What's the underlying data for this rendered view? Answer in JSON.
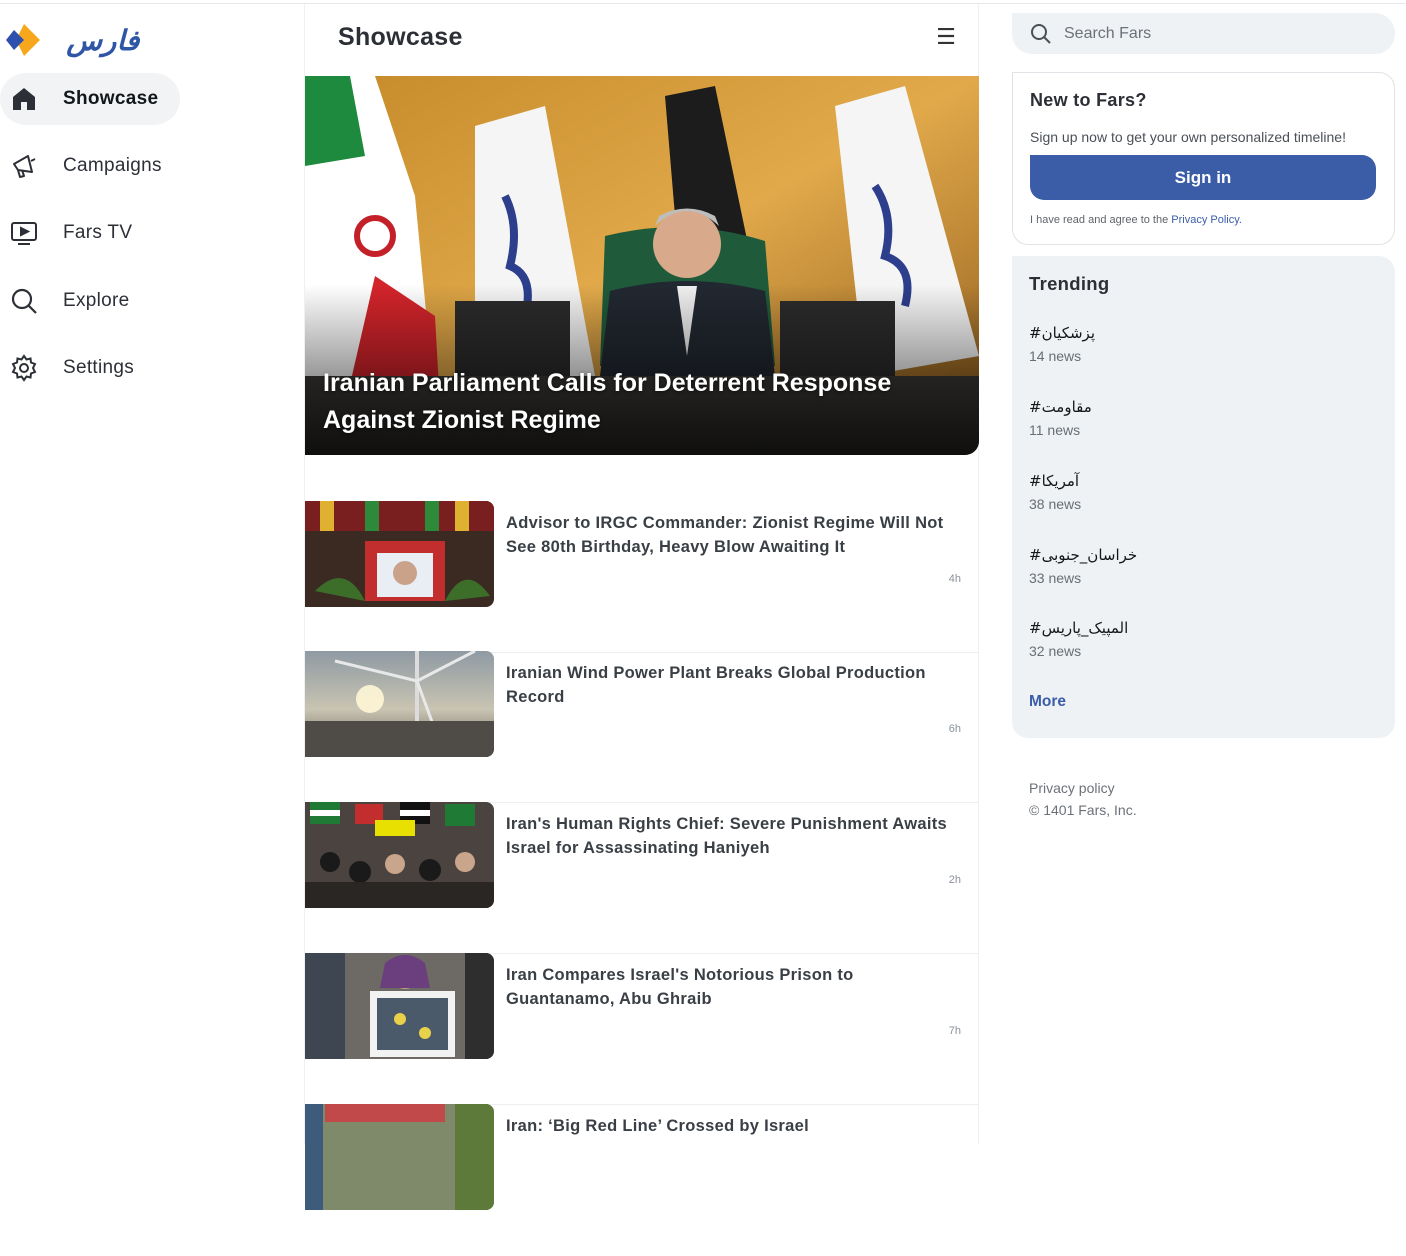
{
  "brand": {
    "logo_text": "فارس",
    "accent": "#3b5da8",
    "logo_blue": "#2d4fae",
    "logo_orange": "#f7a71c"
  },
  "nav": {
    "items": [
      {
        "label": "Showcase",
        "icon": "home-icon",
        "active": true
      },
      {
        "label": "Campaigns",
        "icon": "megaphone-icon",
        "active": false
      },
      {
        "label": "Fars TV",
        "icon": "tv-icon",
        "active": false
      },
      {
        "label": "Explore",
        "icon": "search-icon",
        "active": false
      },
      {
        "label": "Settings",
        "icon": "gear-icon",
        "active": false
      }
    ]
  },
  "main": {
    "title": "Showcase",
    "menu_icon": "☰",
    "hero": {
      "title": "Iranian Parliament Calls for Deterrent Response Against Zionist Regime"
    },
    "stories": [
      {
        "title": "Advisor to IRGC Commander: Zionist Regime Will Not See 80th Birthday, Heavy Blow Awaiting It",
        "time": "4h"
      },
      {
        "title": "Iranian Wind Power Plant Breaks Global Production Record",
        "time": "6h"
      },
      {
        "title": "Iran's Human Rights Chief: Severe Punishment Awaits Israel for Assassinating Haniyeh",
        "time": "2h"
      },
      {
        "title": "Iran Compares Israel's Notorious Prison to Guantanamo, Abu Ghraib",
        "time": "7h"
      },
      {
        "title": "Iran: ‘Big Red Line’ Crossed by Israel",
        "time": ""
      }
    ]
  },
  "search": {
    "placeholder": "Search Fars"
  },
  "signup": {
    "title": "New to Fars?",
    "text": "Sign up now to get your own personalized timeline!",
    "button": "Sign in",
    "agree_prefix": "I have read and agree to the ",
    "agree_link": "Privacy Policy."
  },
  "trending": {
    "title": "Trending",
    "items": [
      {
        "tag": "#پزشکیان",
        "count": "14 news"
      },
      {
        "tag": "#مقاومت",
        "count": "11 news"
      },
      {
        "tag": "#آمریکا",
        "count": "38 news"
      },
      {
        "tag": "#خراسان_جنوبی",
        "count": "33 news"
      },
      {
        "tag": "#المپیک_پاریس",
        "count": "32 news"
      }
    ],
    "more": "More"
  },
  "footer": {
    "privacy": "Privacy policy",
    "copyright": "© 1401 Fars, Inc."
  }
}
